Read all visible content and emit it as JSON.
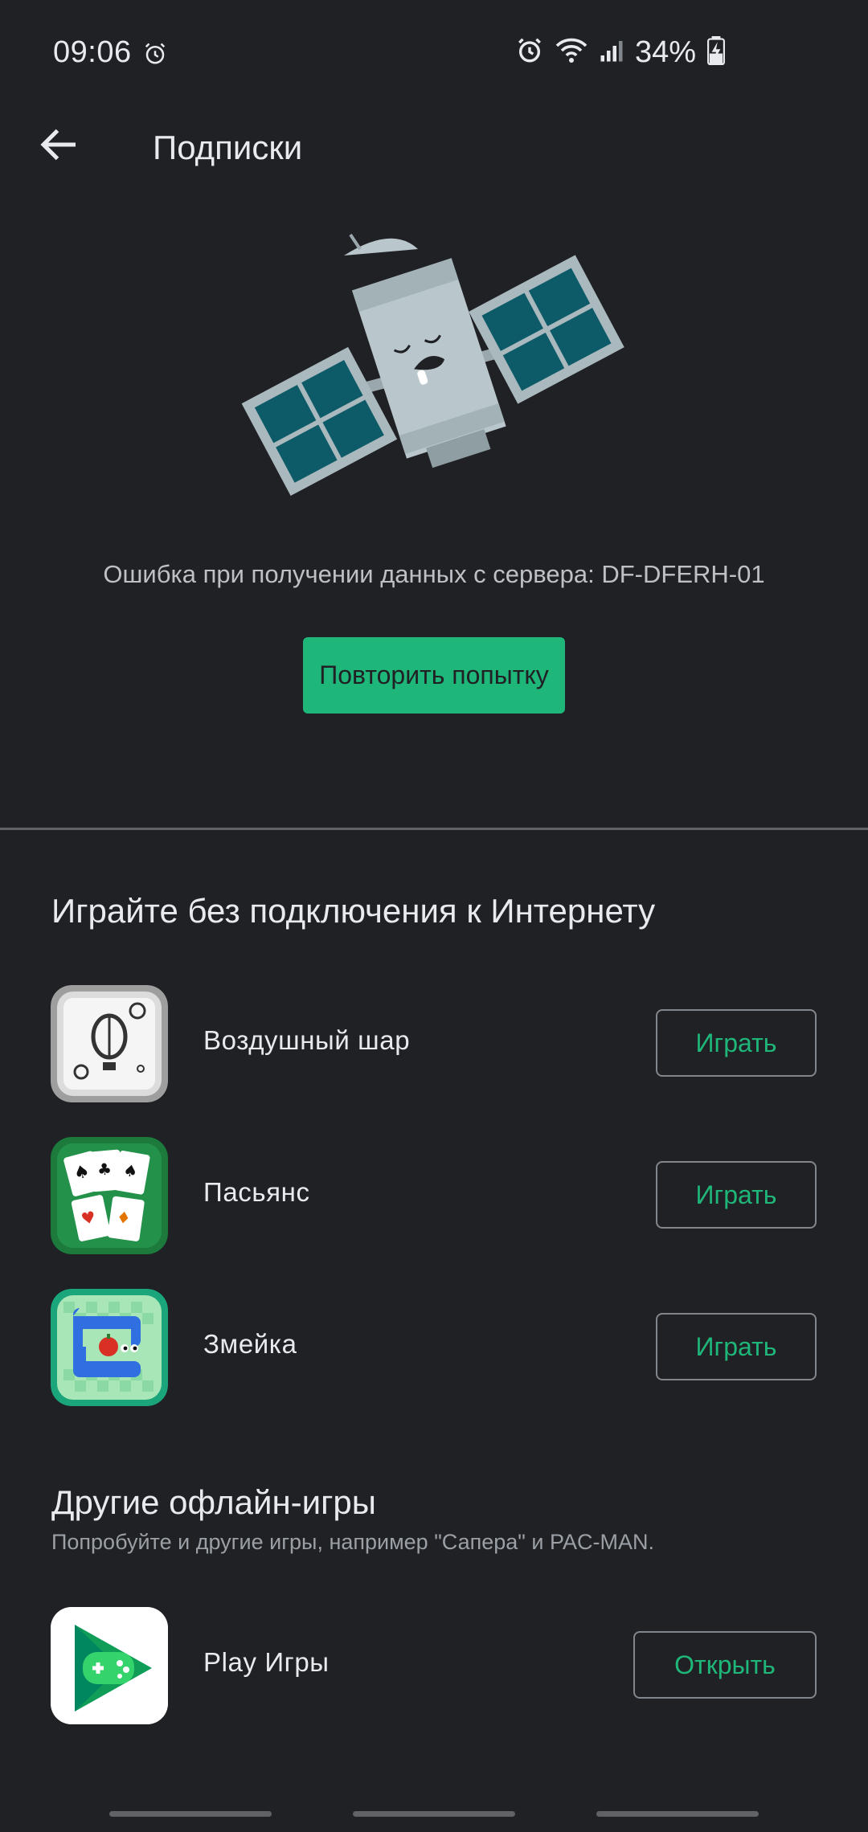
{
  "status_bar": {
    "time": "09:06",
    "battery": "34%"
  },
  "header": {
    "title": "Подписки"
  },
  "error": {
    "message": "Ошибка при получении данных с сервера: DF-DFERH-01",
    "retry_label": "Повторить попытку"
  },
  "offline_games": {
    "title": "Играйте без подключения к Интернету",
    "items": [
      {
        "name": "Воздушный шар",
        "button": "Играть",
        "icon": "balloon-game-icon"
      },
      {
        "name": "Пасьянс",
        "button": "Играть",
        "icon": "solitaire-game-icon"
      },
      {
        "name": "Змейка",
        "button": "Играть",
        "icon": "snake-game-icon"
      }
    ]
  },
  "other_games": {
    "title": "Другие офлайн-игры",
    "subtitle": "Попробуйте и другие игры, например \"Сапера\" и PAC-MAN.",
    "app_name": "Play Игры",
    "button": "Открыть",
    "icon": "play-games-icon"
  },
  "colors": {
    "background": "#202124",
    "accent": "#1fb67a",
    "text": "#e8eaed",
    "secondary_text": "#bdc1c6"
  }
}
